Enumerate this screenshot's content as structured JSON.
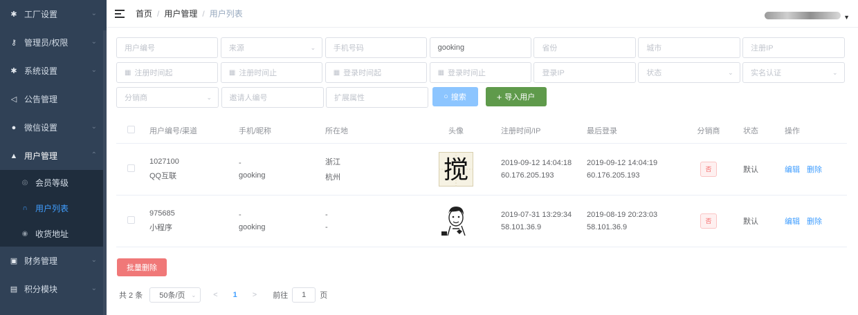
{
  "sidebar": {
    "items": [
      {
        "label": "工厂设置",
        "icon": "gear-icon"
      },
      {
        "label": "管理员/权限",
        "icon": "key-icon"
      },
      {
        "label": "系统设置",
        "icon": "gear-icon"
      },
      {
        "label": "公告管理",
        "icon": "megaphone-icon"
      },
      {
        "label": "微信设置",
        "icon": "wechat-icon"
      },
      {
        "label": "用户管理",
        "icon": "user-icon"
      }
    ],
    "sub_items": [
      {
        "label": "会员等级",
        "icon": "bell-icon"
      },
      {
        "label": "用户列表",
        "icon": "headset-icon"
      },
      {
        "label": "收货地址",
        "icon": "location-icon"
      }
    ],
    "items_after": [
      {
        "label": "财务管理",
        "icon": "money-icon"
      },
      {
        "label": "积分模块",
        "icon": "points-icon"
      }
    ]
  },
  "breadcrumb": [
    "首页",
    "用户管理",
    "用户列表"
  ],
  "filters": {
    "row1": [
      "用户编号",
      "来源",
      "手机号码",
      "gooking",
      "省份",
      "城市",
      "注册IP"
    ],
    "row2": [
      "注册时间起",
      "注册时间止",
      "登录时间起",
      "登录时间止",
      "登录IP",
      "状态",
      "实名认证"
    ],
    "row3": [
      "分销商",
      "邀请人编号",
      "扩展属性"
    ],
    "search_label": "搜索",
    "import_label": "导入用户"
  },
  "table": {
    "headers": [
      "用户编号/渠道",
      "手机/昵称",
      "所在地",
      "头像",
      "注册时间/IP",
      "最后登录",
      "分销商",
      "状态",
      "操作"
    ],
    "rows": [
      {
        "id": "1027100",
        "channel": "QQ互联",
        "phone": "-",
        "nickname": "gooking",
        "province": "浙江",
        "city": "杭州",
        "avatar": "搅",
        "reg_time": "2019-09-12 14:04:18",
        "reg_ip": "60.176.205.193",
        "last_time": "2019-09-12 14:04:19",
        "last_ip": "60.176.205.193",
        "distributor": "否",
        "status": "默认",
        "edit": "编辑",
        "delete": "删除"
      },
      {
        "id": "975685",
        "channel": "小程序",
        "phone": "-",
        "nickname": "gooking",
        "province": "-",
        "city": "-",
        "avatar": "",
        "reg_time": "2019-07-31 13:29:34",
        "reg_ip": "58.101.36.9",
        "last_time": "2019-08-19 20:23:03",
        "last_ip": "58.101.36.9",
        "distributor": "否",
        "status": "默认",
        "edit": "编辑",
        "delete": "删除"
      }
    ]
  },
  "batch_delete_label": "批量删除",
  "pager": {
    "total": "共 2 条",
    "page_size": "50条/页",
    "current": "1",
    "goto_prefix": "前往",
    "goto_value": "1",
    "goto_suffix": "页"
  }
}
